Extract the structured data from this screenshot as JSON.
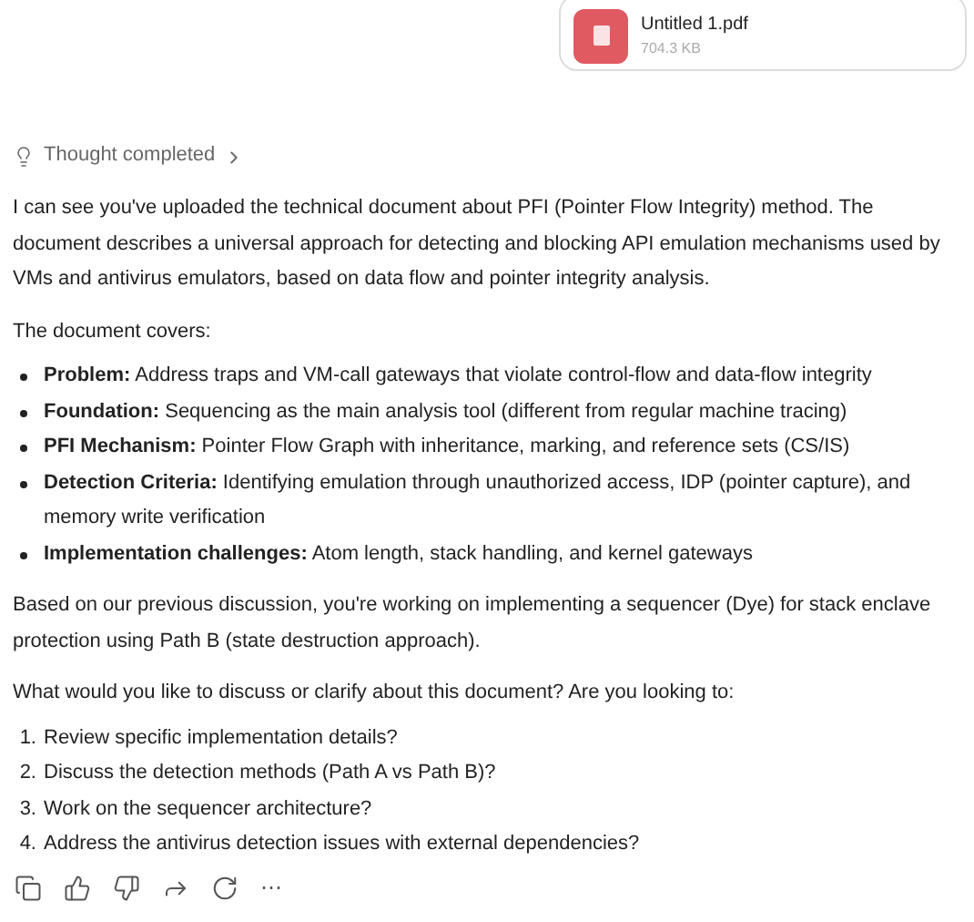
{
  "attachment": {
    "name": "Untitled 1.pdf",
    "size": "704.3 KB"
  },
  "thought": {
    "label": "Thought completed",
    "expanded": false
  },
  "intro": "I can see you've uploaded the technical document about PFI (Pointer Flow Integrity) method. The document describes a universal approach for detecting and blocking API emulation mechanisms used by VMs and antivirus emulators, based on data flow and pointer integrity analysis.",
  "covers_heading": "The document covers:",
  "bullets": [
    {
      "text": "**Problem:** Address traps and VM-call gateways that violate control-flow and data-flow integrity"
    },
    {
      "text": "**Foundation:** Sequencing as the main analysis tool (different from regular machine tracing)"
    },
    {
      "text": "**PFI Mechanism:** Pointer Flow Graph with inheritance, marking, and reference sets (CS/IS)"
    },
    {
      "text": "**Detection Criteria:** Identifying emulation through unauthorized access, IDP (pointer capture), and memory write verification"
    },
    {
      "text": "**Implementation challenges:** Atom length, stack handling, and kernel gateways"
    }
  ],
  "context": "Based on our previous discussion, you're working on implementing a sequencer (Dye) for stack enclave protection using Path B (state destruction approach).",
  "question": "What would you like to discuss or clarify about this document? Are you looking to:",
  "options": [
    {
      "number": "1.",
      "text": "Review specific implementation details?"
    },
    {
      "number": "2.",
      "text": "Discuss the detection methods (Path A vs Path B)?"
    },
    {
      "number": "3.",
      "text": "Work on the sequencer architecture?"
    },
    {
      "number": "4.",
      "text": "Address the antivirus detection issues with external dependencies?"
    }
  ],
  "more_label": "⋯"
}
